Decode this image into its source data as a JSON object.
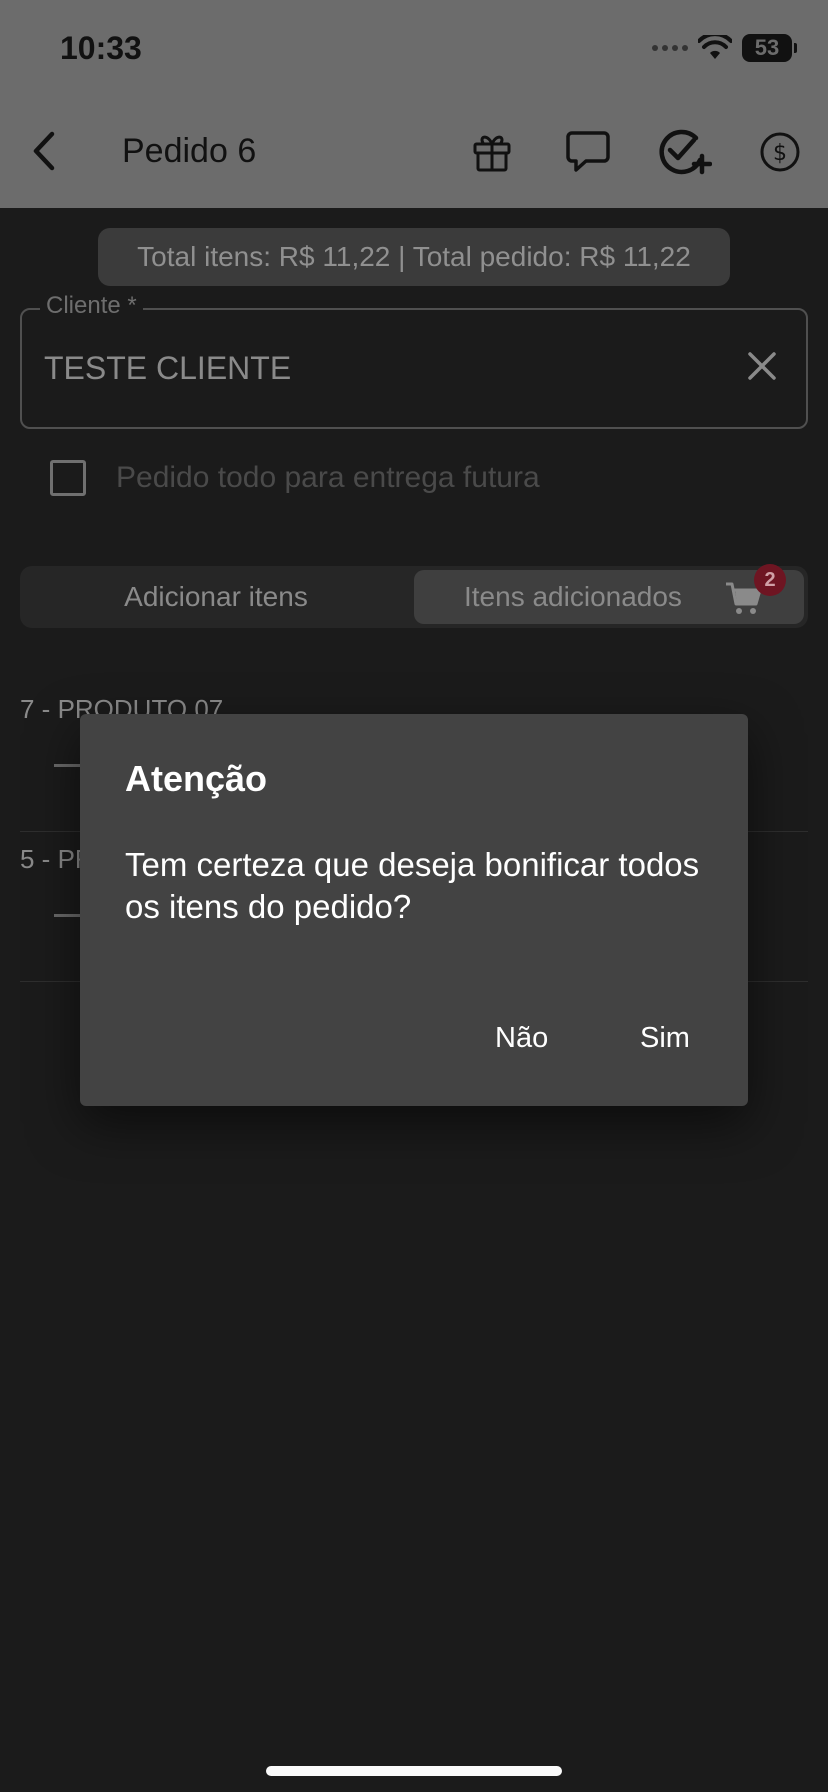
{
  "status_bar": {
    "time": "10:33",
    "battery": "53"
  },
  "header": {
    "title": "Pedido 6"
  },
  "totals": {
    "text": "Total itens: R$ 11,22 | Total pedido: R$ 11,22"
  },
  "client": {
    "label": "Cliente *",
    "value": "TESTE CLIENTE"
  },
  "future_delivery": {
    "label": "Pedido todo para entrega futura",
    "checked": false
  },
  "tabs": {
    "add_items": "Adicionar itens",
    "added_items": "Itens adicionados",
    "cart_count": "2"
  },
  "products": [
    {
      "label": "7 - PRODUTO 07"
    },
    {
      "label": "5 - PR"
    }
  ],
  "dialog": {
    "title": "Atenção",
    "message": "Tem certeza que deseja bonificar todos os itens do pedido?",
    "no_label": "Não",
    "yes_label": "Sim"
  },
  "icons": {
    "back": "chevron-left-icon",
    "gift": "gift-icon",
    "comment": "chat-bubble-icon",
    "check_add": "check-circle-plus-icon",
    "money": "dollar-circle-icon",
    "clear": "close-icon",
    "cart": "cart-icon"
  },
  "colors": {
    "overlay_bar": "#6c6c6c",
    "background": "#1b1b1b",
    "dialog": "#434343",
    "badge": "#6e1522"
  }
}
